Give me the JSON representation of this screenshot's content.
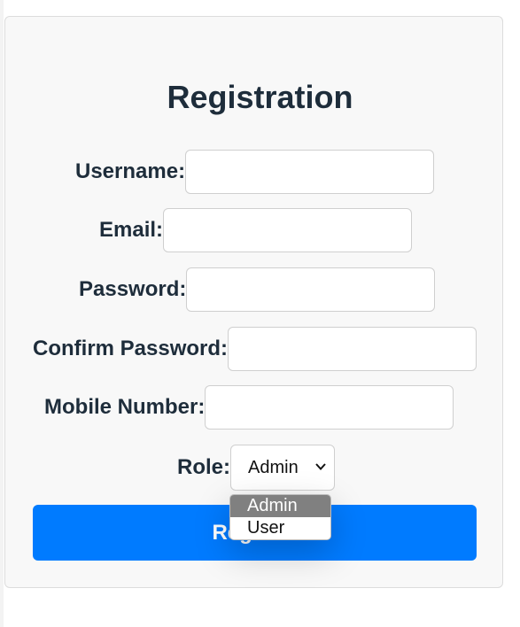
{
  "form": {
    "title": "Registration",
    "fields": [
      {
        "label": "Username:",
        "value": ""
      },
      {
        "label": "Email:",
        "value": ""
      },
      {
        "label": "Password:",
        "value": ""
      },
      {
        "label": "Confirm Password:",
        "value": ""
      },
      {
        "label": "Mobile Number:",
        "value": ""
      }
    ],
    "role": {
      "label": "Role:",
      "selected": "Admin",
      "options": [
        "Admin",
        "User"
      ]
    },
    "submit_label": "Register"
  },
  "colors": {
    "primary": "#007bff",
    "text": "#1e2d3b",
    "card_bg": "#f8f8f8",
    "option_highlight": "#808080"
  }
}
